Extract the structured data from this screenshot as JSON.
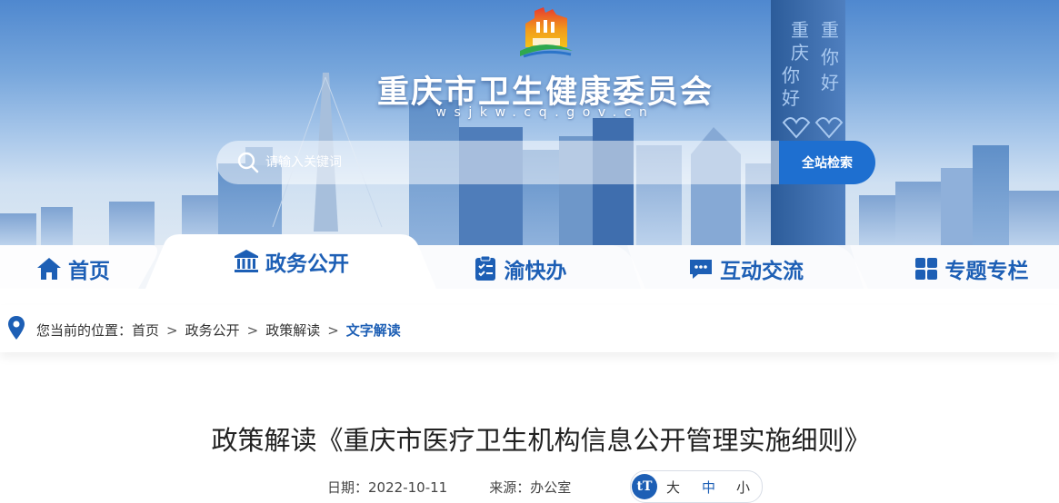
{
  "site": {
    "title": "重庆市卫生健康委员会",
    "domain": "wsjkw.cq.gov.cn"
  },
  "search": {
    "placeholder": "请输入关键词",
    "button_label": "全站检索"
  },
  "nav": {
    "items": [
      {
        "label": "首页",
        "icon": "home-icon",
        "active": false
      },
      {
        "label": "政务公开",
        "icon": "government-building-icon",
        "active": true
      },
      {
        "label": "渝快办",
        "icon": "checklist-icon",
        "active": false
      },
      {
        "label": "互动交流",
        "icon": "chat-icon",
        "active": false
      },
      {
        "label": "专题专栏",
        "icon": "grid-icon",
        "active": false
      }
    ]
  },
  "breadcrumb": {
    "prefix": "您当前的位置：",
    "items": [
      "首页",
      "政务公开",
      "政策解读"
    ],
    "current": "文字解读",
    "separator": ">"
  },
  "article": {
    "title": "政策解读《重庆市医疗卫生机构信息公开管理实施细则》",
    "date_label": "日期：",
    "date": "2022-10-11",
    "source_label": "来源：",
    "source": "办公室",
    "font_size": {
      "large": "大",
      "medium": "中",
      "small": "小",
      "selected": "medium"
    }
  },
  "colors": {
    "brand_blue": "#1d5fb5",
    "button_blue": "#1e6fd0"
  }
}
